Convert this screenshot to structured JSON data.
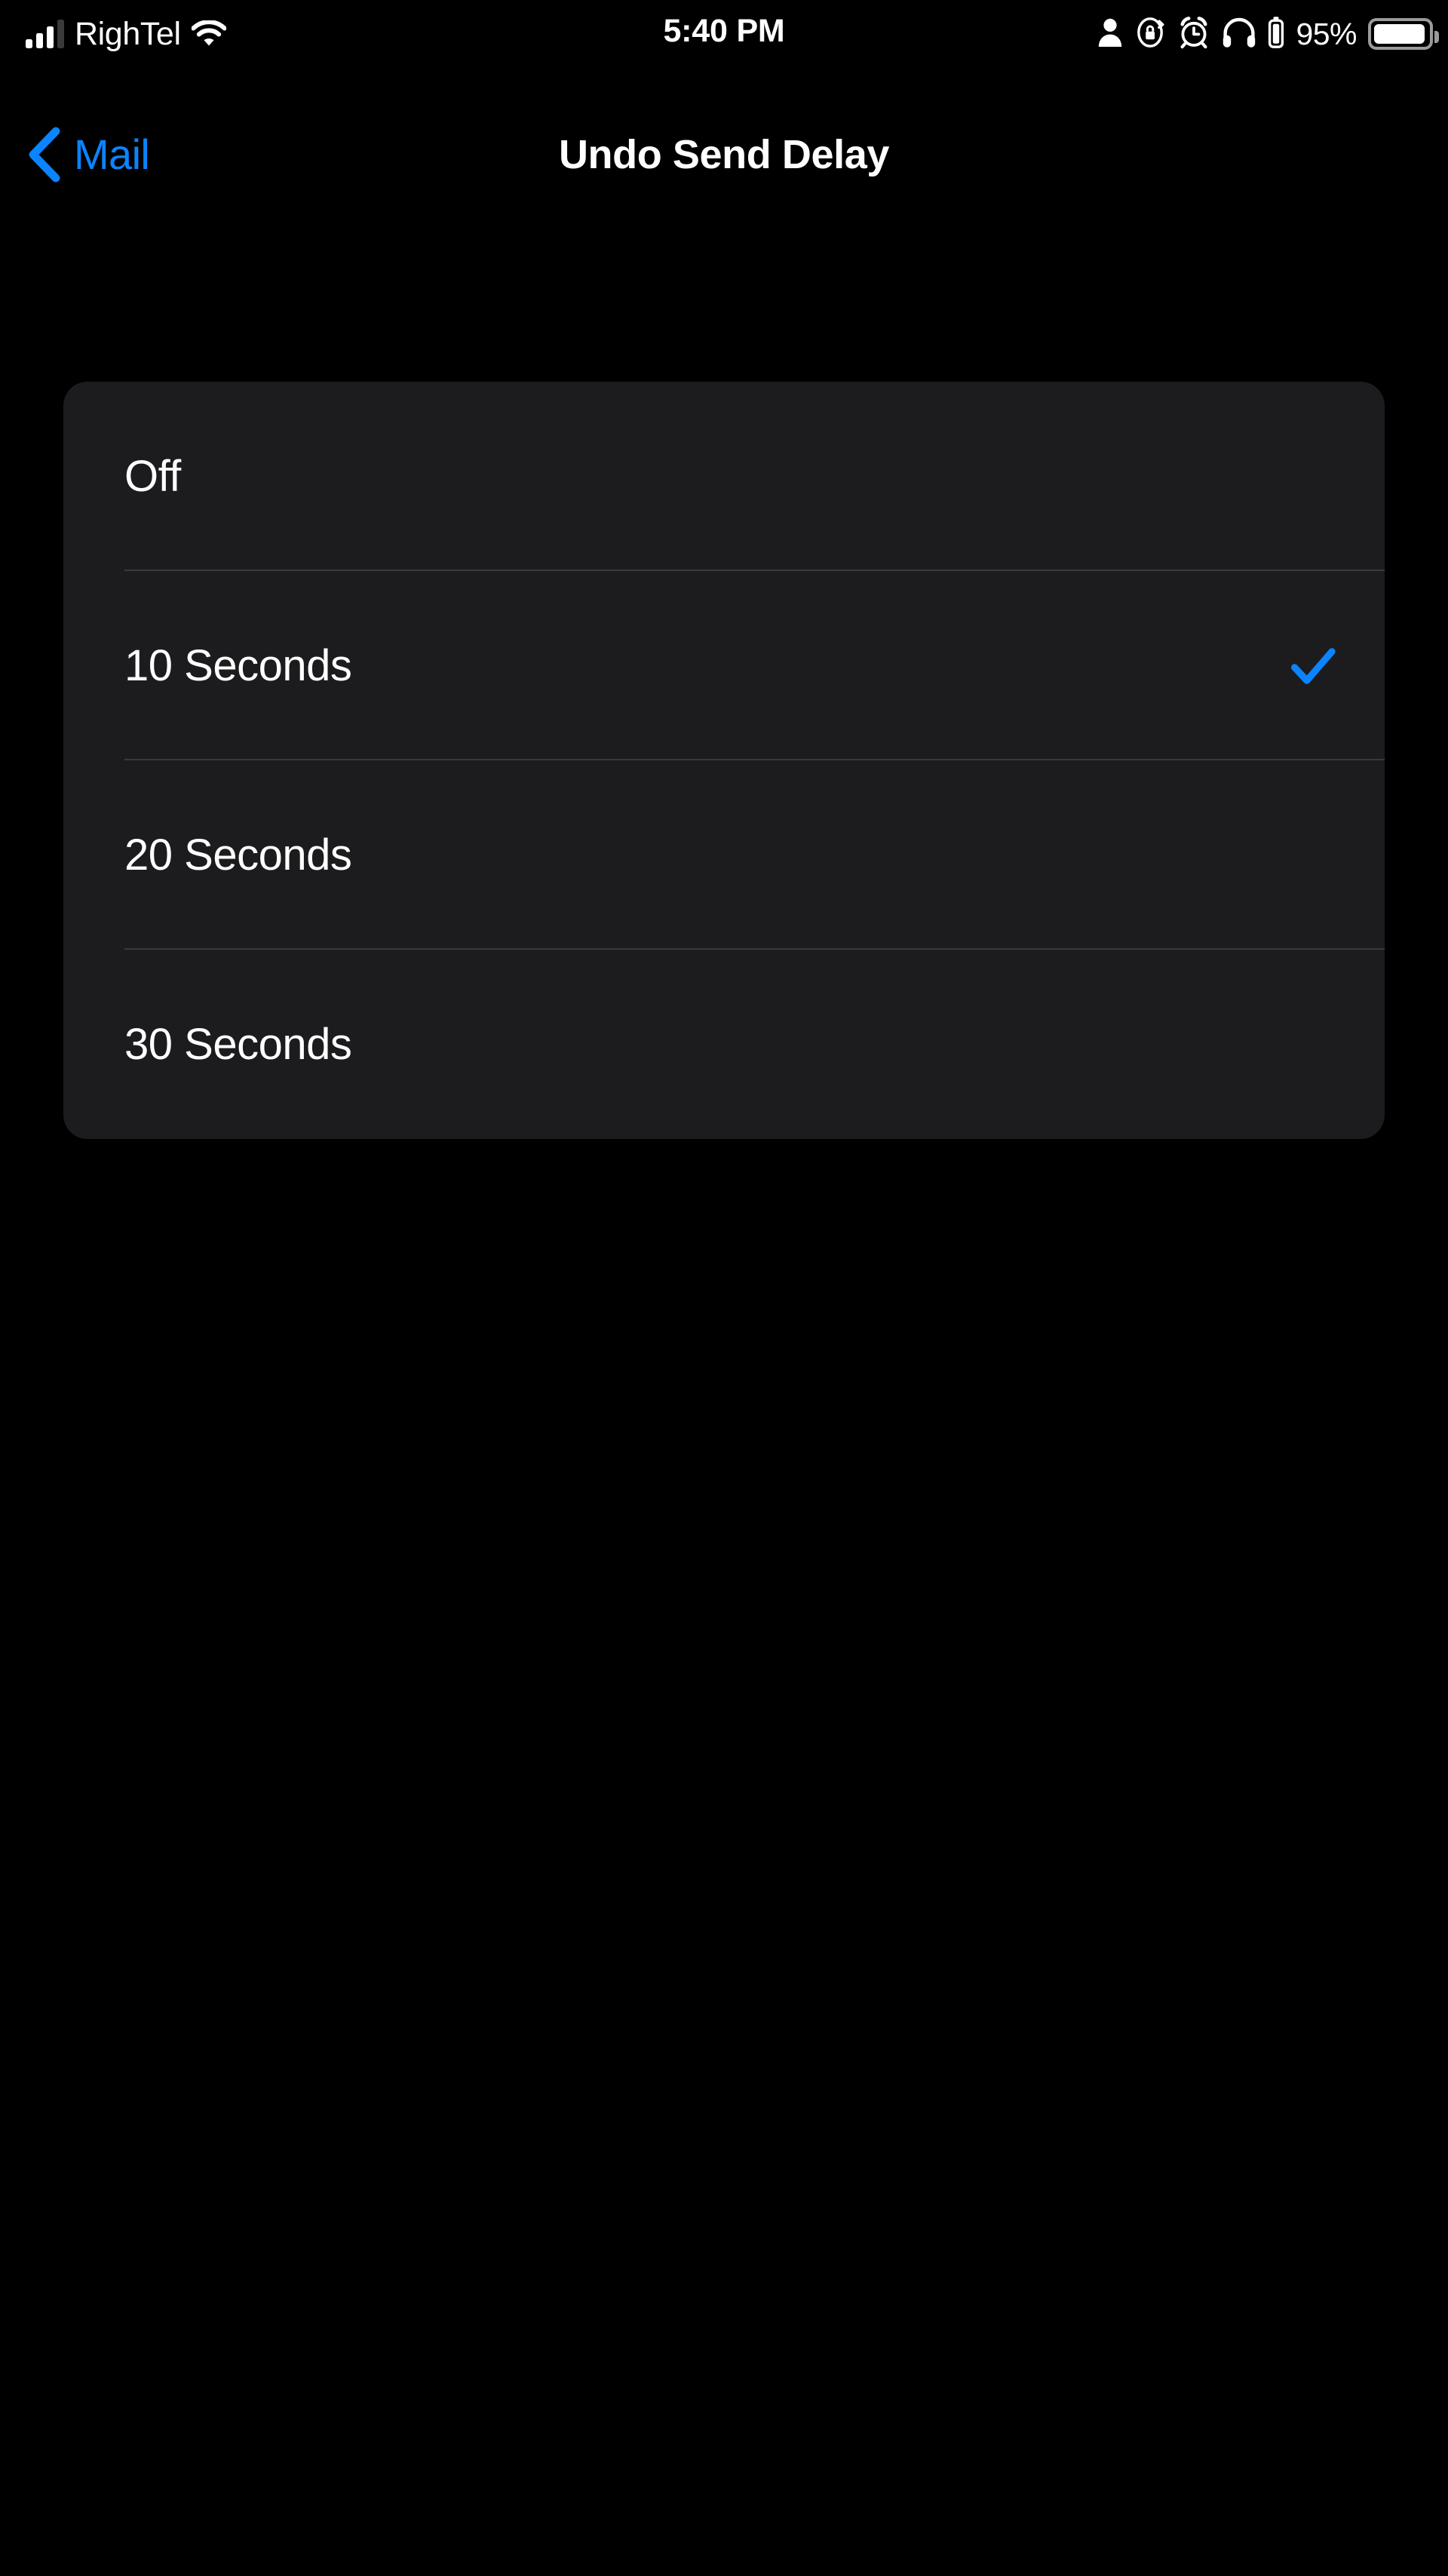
{
  "status_bar": {
    "carrier": "RighTel",
    "signal_icon": "cellular-signal-bars",
    "signal_bars_total": 4,
    "signal_bars_filled": 3,
    "wifi_icon": "wifi-icon",
    "time": "5:40 PM",
    "right_icons": [
      {
        "name": "person-icon",
        "glyph": "person"
      },
      {
        "name": "rotation-lock-icon",
        "glyph": "rotation-lock"
      },
      {
        "name": "alarm-clock-icon",
        "glyph": "alarm"
      },
      {
        "name": "headphones-icon",
        "glyph": "headphones"
      },
      {
        "name": "headphone-battery-icon",
        "glyph": "headphone-battery"
      }
    ],
    "battery_percent": "95%",
    "battery_level": 95,
    "battery_icon": "battery-icon"
  },
  "nav_bar": {
    "back_icon": "chevron-left-icon",
    "back_label": "Mail",
    "title": "Undo Send Delay"
  },
  "settings_list": {
    "selected_value": "10 Seconds",
    "checkmark_icon": "checkmark-icon",
    "rows": [
      {
        "label": "Off",
        "selected": false
      },
      {
        "label": "10 Seconds",
        "selected": true
      },
      {
        "label": "20 Seconds",
        "selected": false
      },
      {
        "label": "30 Seconds",
        "selected": false
      }
    ]
  },
  "colors": {
    "background": "#000000",
    "card_background": "#1C1C1E",
    "accent_blue": "#0A84FF",
    "primary_text": "#FFFFFF",
    "separator": "#3A3A3C"
  }
}
